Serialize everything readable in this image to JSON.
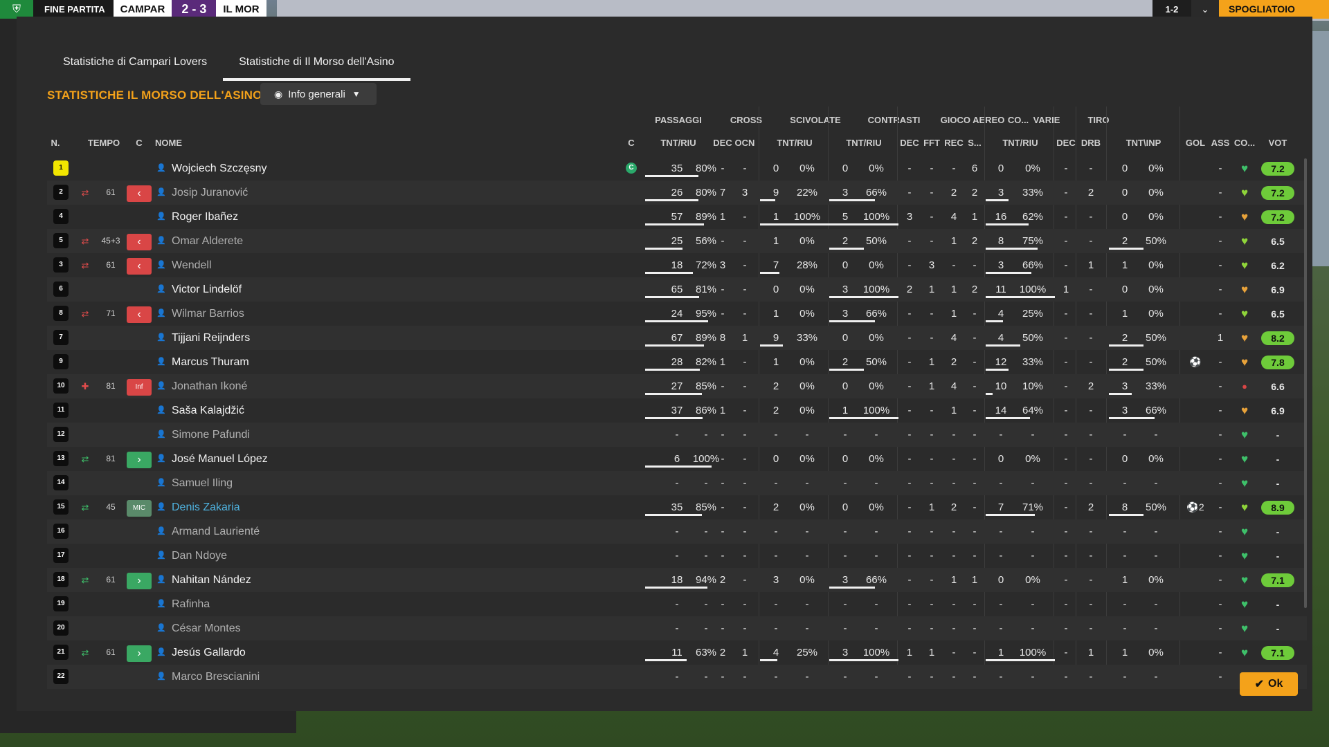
{
  "topbar": {
    "status": "FINE PARTITA",
    "home_abbr": "CAMPAR",
    "score": "2 - 3",
    "away_abbr": "IL MOR",
    "right_value": "1-2",
    "continue_label": "SPOGLIATOIO"
  },
  "tabs": [
    {
      "label": "Statistiche di Campari Lovers",
      "active": false
    },
    {
      "label": "Statistiche di Il Morso dell'Asino",
      "active": true
    }
  ],
  "section_title": "STATISTICHE IL MORSO DELL'ASINO",
  "view_dropdown": {
    "label": "Info generali",
    "icon": "eye-icon"
  },
  "groups": [
    "PASSAGGI",
    "CROSS",
    "SCIVOLATE",
    "CONTRASTI",
    "GIOCO AEREO",
    "CO...",
    "VARIE",
    "TIRO"
  ],
  "headers": {
    "n": "N.",
    "tempo": "TEMPO",
    "c": "C",
    "nome": "NOME",
    "cap": "C",
    "pass_tr": "TNT/RIU",
    "pass_dec": "DEC",
    "pass_ocn": "OCN",
    "cross_tr": "TNT/RIU",
    "sciv_tr": "TNT/RIU",
    "con_dec": "DEC",
    "con_fft": "FFT",
    "con_rec": "REC",
    "con_s": "S...",
    "aereo_tr": "TNT/RIU",
    "co_dec": "DEC",
    "varie_drb": "DRB",
    "tiro_ti": "TNT\\INP",
    "gol": "GOL",
    "ass": "ASS",
    "co": "CO...",
    "vot": "VOT"
  },
  "players": [
    {
      "n": "1",
      "gk": true,
      "sub": "",
      "tempo": "",
      "role": "",
      "name": "Wojciech Szczęsny",
      "style": "normal",
      "captain": "C",
      "pt": "35",
      "pp": "80%",
      "pdec": "-",
      "pocn": "-",
      "ct": "0",
      "cp": "0%",
      "st": "0",
      "sp": "0%",
      "cdec": "-",
      "cfft": "-",
      "crec": "-",
      "cs": "6",
      "at": "0",
      "ap": "0%",
      "codec": "-",
      "drb": "-",
      "tt": "0",
      "tp": "0%",
      "gol": "",
      "ass": "-",
      "morale": "green",
      "vote": "7.2",
      "vote_good": true
    },
    {
      "n": "2",
      "gk": false,
      "sub": "out",
      "tempo": "61",
      "role": "red",
      "name": "Josip Juranović",
      "style": "dim",
      "captain": "",
      "pt": "26",
      "pp": "80%",
      "pdec": "7",
      "pocn": "3",
      "ct": "9",
      "cp": "22%",
      "st": "3",
      "sp": "66%",
      "cdec": "-",
      "cfft": "-",
      "crec": "2",
      "cs": "2",
      "at": "3",
      "ap": "33%",
      "codec": "-",
      "drb": "2",
      "tt": "0",
      "tp": "0%",
      "gol": "",
      "ass": "-",
      "morale": "lime",
      "vote": "7.2",
      "vote_good": true
    },
    {
      "n": "4",
      "gk": false,
      "sub": "",
      "tempo": "",
      "role": "",
      "name": "Roger Ibañez",
      "style": "normal",
      "captain": "",
      "pt": "57",
      "pp": "89%",
      "pdec": "1",
      "pocn": "-",
      "ct": "1",
      "cp": "100%",
      "st": "5",
      "sp": "100%",
      "cdec": "3",
      "cfft": "-",
      "crec": "4",
      "cs": "1",
      "at": "16",
      "ap": "62%",
      "codec": "-",
      "drb": "-",
      "tt": "0",
      "tp": "0%",
      "gol": "",
      "ass": "-",
      "morale": "orange",
      "vote": "7.2",
      "vote_good": true
    },
    {
      "n": "5",
      "gk": false,
      "sub": "out",
      "tempo": "45+3",
      "role": "red",
      "name": "Omar Alderete",
      "style": "dim",
      "captain": "",
      "pt": "25",
      "pp": "56%",
      "pdec": "-",
      "pocn": "-",
      "ct": "1",
      "cp": "0%",
      "st": "2",
      "sp": "50%",
      "cdec": "-",
      "cfft": "-",
      "crec": "1",
      "cs": "2",
      "at": "8",
      "ap": "75%",
      "codec": "-",
      "drb": "-",
      "tt": "2",
      "tp": "50%",
      "gol": "",
      "ass": "-",
      "morale": "lime",
      "vote": "6.5",
      "vote_good": false
    },
    {
      "n": "3",
      "gk": false,
      "sub": "out",
      "tempo": "61",
      "role": "red",
      "name": "Wendell",
      "style": "dim",
      "captain": "",
      "pt": "18",
      "pp": "72%",
      "pdec": "3",
      "pocn": "-",
      "ct": "7",
      "cp": "28%",
      "st": "0",
      "sp": "0%",
      "cdec": "-",
      "cfft": "3",
      "crec": "-",
      "cs": "-",
      "at": "3",
      "ap": "66%",
      "codec": "-",
      "drb": "1",
      "tt": "1",
      "tp": "0%",
      "gol": "",
      "ass": "-",
      "morale": "lime",
      "vote": "6.2",
      "vote_good": false
    },
    {
      "n": "6",
      "gk": false,
      "sub": "",
      "tempo": "",
      "role": "",
      "name": "Victor Lindelöf",
      "style": "normal",
      "captain": "",
      "pt": "65",
      "pp": "81%",
      "pdec": "-",
      "pocn": "-",
      "ct": "0",
      "cp": "0%",
      "st": "3",
      "sp": "100%",
      "cdec": "2",
      "cfft": "1",
      "crec": "1",
      "cs": "2",
      "at": "11",
      "ap": "100%",
      "codec": "1",
      "drb": "-",
      "tt": "0",
      "tp": "0%",
      "gol": "",
      "ass": "-",
      "morale": "orange",
      "vote": "6.9",
      "vote_good": false
    },
    {
      "n": "8",
      "gk": false,
      "sub": "out",
      "tempo": "71",
      "role": "red",
      "name": "Wilmar Barrios",
      "style": "dim",
      "captain": "",
      "pt": "24",
      "pp": "95%",
      "pdec": "-",
      "pocn": "-",
      "ct": "1",
      "cp": "0%",
      "st": "3",
      "sp": "66%",
      "cdec": "-",
      "cfft": "-",
      "crec": "1",
      "cs": "-",
      "at": "4",
      "ap": "25%",
      "codec": "-",
      "drb": "-",
      "tt": "1",
      "tp": "0%",
      "gol": "",
      "ass": "-",
      "morale": "lime",
      "vote": "6.5",
      "vote_good": false
    },
    {
      "n": "7",
      "gk": false,
      "sub": "",
      "tempo": "",
      "role": "",
      "name": "Tijjani Reijnders",
      "style": "normal",
      "captain": "",
      "pt": "67",
      "pp": "89%",
      "pdec": "8",
      "pocn": "1",
      "ct": "9",
      "cp": "33%",
      "st": "0",
      "sp": "0%",
      "cdec": "-",
      "cfft": "-",
      "crec": "4",
      "cs": "-",
      "at": "4",
      "ap": "50%",
      "codec": "-",
      "drb": "-",
      "tt": "2",
      "tp": "50%",
      "gol": "",
      "ass": "1",
      "morale": "orange",
      "vote": "8.2",
      "vote_good": true
    },
    {
      "n": "9",
      "gk": false,
      "sub": "",
      "tempo": "",
      "role": "",
      "name": "Marcus Thuram",
      "style": "normal",
      "captain": "",
      "pt": "28",
      "pp": "82%",
      "pdec": "1",
      "pocn": "-",
      "ct": "1",
      "cp": "0%",
      "st": "2",
      "sp": "50%",
      "cdec": "-",
      "cfft": "1",
      "crec": "2",
      "cs": "-",
      "at": "12",
      "ap": "33%",
      "codec": "-",
      "drb": "-",
      "tt": "2",
      "tp": "50%",
      "gol": "⚽",
      "ass": "-",
      "morale": "orange",
      "vote": "7.8",
      "vote_good": true
    },
    {
      "n": "10",
      "gk": false,
      "sub": "inj",
      "tempo": "81",
      "role": "inf",
      "name": "Jonathan Ikoné",
      "style": "dim",
      "captain": "",
      "pt": "27",
      "pp": "85%",
      "pdec": "-",
      "pocn": "-",
      "ct": "2",
      "cp": "0%",
      "st": "0",
      "sp": "0%",
      "cdec": "-",
      "cfft": "1",
      "crec": "4",
      "cs": "-",
      "at": "10",
      "ap": "10%",
      "codec": "-",
      "drb": "2",
      "tt": "3",
      "tp": "33%",
      "gol": "",
      "ass": "-",
      "morale": "red",
      "vote": "6.6",
      "vote_good": false
    },
    {
      "n": "11",
      "gk": false,
      "sub": "",
      "tempo": "",
      "role": "",
      "name": "Saša Kalajdžić",
      "style": "normal",
      "captain": "",
      "pt": "37",
      "pp": "86%",
      "pdec": "1",
      "pocn": "-",
      "ct": "2",
      "cp": "0%",
      "st": "1",
      "sp": "100%",
      "cdec": "-",
      "cfft": "-",
      "crec": "1",
      "cs": "-",
      "at": "14",
      "ap": "64%",
      "codec": "-",
      "drb": "-",
      "tt": "3",
      "tp": "66%",
      "gol": "",
      "ass": "-",
      "morale": "orange",
      "vote": "6.9",
      "vote_good": false
    },
    {
      "n": "12",
      "gk": false,
      "sub": "",
      "tempo": "",
      "role": "",
      "name": "Simone Pafundi",
      "style": "dim",
      "captain": "",
      "pt": "-",
      "pp": "-",
      "pdec": "-",
      "pocn": "-",
      "ct": "-",
      "cp": "-",
      "st": "-",
      "sp": "-",
      "cdec": "-",
      "cfft": "-",
      "crec": "-",
      "cs": "-",
      "at": "-",
      "ap": "-",
      "codec": "-",
      "drb": "-",
      "tt": "-",
      "tp": "-",
      "gol": "",
      "ass": "-",
      "morale": "green",
      "vote": "-",
      "vote_good": false
    },
    {
      "n": "13",
      "gk": false,
      "sub": "in",
      "tempo": "81",
      "role": "green",
      "name": "José Manuel López",
      "style": "normal",
      "captain": "",
      "pt": "6",
      "pp": "100%",
      "pdec": "-",
      "pocn": "-",
      "ct": "0",
      "cp": "0%",
      "st": "0",
      "sp": "0%",
      "cdec": "-",
      "cfft": "-",
      "crec": "-",
      "cs": "-",
      "at": "0",
      "ap": "0%",
      "codec": "-",
      "drb": "-",
      "tt": "0",
      "tp": "0%",
      "gol": "",
      "ass": "-",
      "morale": "green",
      "vote": "-",
      "vote_good": false
    },
    {
      "n": "14",
      "gk": false,
      "sub": "",
      "tempo": "",
      "role": "",
      "name": "Samuel Iling",
      "style": "dim",
      "captain": "",
      "pt": "-",
      "pp": "-",
      "pdec": "-",
      "pocn": "-",
      "ct": "-",
      "cp": "-",
      "st": "-",
      "sp": "-",
      "cdec": "-",
      "cfft": "-",
      "crec": "-",
      "cs": "-",
      "at": "-",
      "ap": "-",
      "codec": "-",
      "drb": "-",
      "tt": "-",
      "tp": "-",
      "gol": "",
      "ass": "-",
      "morale": "green",
      "vote": "-",
      "vote_good": false
    },
    {
      "n": "15",
      "gk": false,
      "sub": "in",
      "tempo": "45",
      "role": "mic",
      "name": "Denis Zakaria",
      "style": "hl",
      "captain": "",
      "pt": "35",
      "pp": "85%",
      "pdec": "-",
      "pocn": "-",
      "ct": "2",
      "cp": "0%",
      "st": "0",
      "sp": "0%",
      "cdec": "-",
      "cfft": "1",
      "crec": "2",
      "cs": "-",
      "at": "7",
      "ap": "71%",
      "codec": "-",
      "drb": "2",
      "tt": "8",
      "tp": "50%",
      "gol": "⚽2",
      "ass": "-",
      "morale": "lime",
      "vote": "8.9",
      "vote_good": true
    },
    {
      "n": "16",
      "gk": false,
      "sub": "",
      "tempo": "",
      "role": "",
      "name": "Armand Laurienté",
      "style": "dim",
      "captain": "",
      "pt": "-",
      "pp": "-",
      "pdec": "-",
      "pocn": "-",
      "ct": "-",
      "cp": "-",
      "st": "-",
      "sp": "-",
      "cdec": "-",
      "cfft": "-",
      "crec": "-",
      "cs": "-",
      "at": "-",
      "ap": "-",
      "codec": "-",
      "drb": "-",
      "tt": "-",
      "tp": "-",
      "gol": "",
      "ass": "-",
      "morale": "green",
      "vote": "-",
      "vote_good": false
    },
    {
      "n": "17",
      "gk": false,
      "sub": "",
      "tempo": "",
      "role": "",
      "name": "Dan Ndoye",
      "style": "dim",
      "captain": "",
      "pt": "-",
      "pp": "-",
      "pdec": "-",
      "pocn": "-",
      "ct": "-",
      "cp": "-",
      "st": "-",
      "sp": "-",
      "cdec": "-",
      "cfft": "-",
      "crec": "-",
      "cs": "-",
      "at": "-",
      "ap": "-",
      "codec": "-",
      "drb": "-",
      "tt": "-",
      "tp": "-",
      "gol": "",
      "ass": "-",
      "morale": "green",
      "vote": "-",
      "vote_good": false
    },
    {
      "n": "18",
      "gk": false,
      "sub": "in",
      "tempo": "61",
      "role": "green",
      "name": "Nahitan Nández",
      "style": "normal",
      "captain": "",
      "pt": "18",
      "pp": "94%",
      "pdec": "2",
      "pocn": "-",
      "ct": "3",
      "cp": "0%",
      "st": "3",
      "sp": "66%",
      "cdec": "-",
      "cfft": "-",
      "crec": "1",
      "cs": "1",
      "at": "0",
      "ap": "0%",
      "codec": "-",
      "drb": "-",
      "tt": "1",
      "tp": "0%",
      "gol": "",
      "ass": "-",
      "morale": "green",
      "vote": "7.1",
      "vote_good": true
    },
    {
      "n": "19",
      "gk": false,
      "sub": "",
      "tempo": "",
      "role": "",
      "name": "Rafinha",
      "style": "dim",
      "captain": "",
      "pt": "-",
      "pp": "-",
      "pdec": "-",
      "pocn": "-",
      "ct": "-",
      "cp": "-",
      "st": "-",
      "sp": "-",
      "cdec": "-",
      "cfft": "-",
      "crec": "-",
      "cs": "-",
      "at": "-",
      "ap": "-",
      "codec": "-",
      "drb": "-",
      "tt": "-",
      "tp": "-",
      "gol": "",
      "ass": "-",
      "morale": "green",
      "vote": "-",
      "vote_good": false
    },
    {
      "n": "20",
      "gk": false,
      "sub": "",
      "tempo": "",
      "role": "",
      "name": "César Montes",
      "style": "dim",
      "captain": "",
      "pt": "-",
      "pp": "-",
      "pdec": "-",
      "pocn": "-",
      "ct": "-",
      "cp": "-",
      "st": "-",
      "sp": "-",
      "cdec": "-",
      "cfft": "-",
      "crec": "-",
      "cs": "-",
      "at": "-",
      "ap": "-",
      "codec": "-",
      "drb": "-",
      "tt": "-",
      "tp": "-",
      "gol": "",
      "ass": "-",
      "morale": "green",
      "vote": "-",
      "vote_good": false
    },
    {
      "n": "21",
      "gk": false,
      "sub": "in",
      "tempo": "61",
      "role": "green",
      "name": "Jesús Gallardo",
      "style": "normal",
      "captain": "",
      "pt": "11",
      "pp": "63%",
      "pdec": "2",
      "pocn": "1",
      "ct": "4",
      "cp": "25%",
      "st": "3",
      "sp": "100%",
      "cdec": "1",
      "cfft": "1",
      "crec": "-",
      "cs": "-",
      "at": "1",
      "ap": "100%",
      "codec": "-",
      "drb": "1",
      "tt": "1",
      "tp": "0%",
      "gol": "",
      "ass": "-",
      "morale": "green",
      "vote": "7.1",
      "vote_good": true
    },
    {
      "n": "22",
      "gk": false,
      "sub": "",
      "tempo": "",
      "role": "",
      "name": "Marco Brescianini",
      "style": "dim",
      "captain": "",
      "pt": "-",
      "pp": "-",
      "pdec": "-",
      "pocn": "-",
      "ct": "-",
      "cp": "-",
      "st": "-",
      "sp": "-",
      "cdec": "-",
      "cfft": "-",
      "crec": "-",
      "cs": "-",
      "at": "-",
      "ap": "-",
      "codec": "-",
      "drb": "-",
      "tt": "-",
      "tp": "-",
      "gol": "",
      "ass": "-",
      "morale": "green",
      "vote": "-",
      "vote_good": false
    }
  ],
  "role_labels": {
    "inf": "Inf",
    "mic": "MIC"
  },
  "ok_label": "Ok",
  "colors": {
    "accent": "#f4a21a",
    "vote_good": "#6ecb3a",
    "sub_out": "#d94646",
    "sub_in": "#3aa863",
    "highlight_name": "#4fb3e0"
  }
}
